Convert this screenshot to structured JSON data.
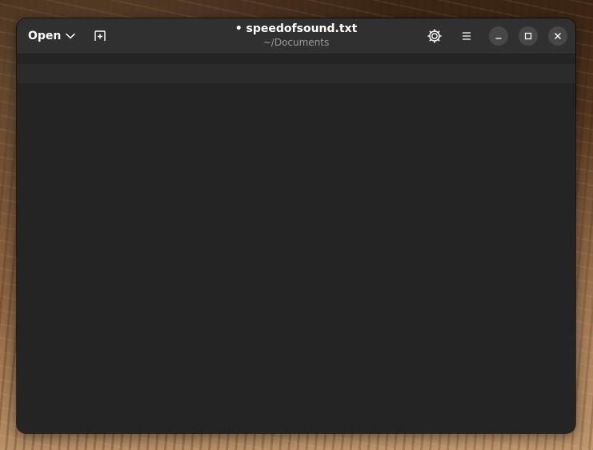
{
  "window": {
    "title": "speedofsound.txt",
    "modified_marker": "•",
    "subtitle": "~/Documents"
  },
  "headerbar": {
    "open_label": "Open",
    "open_icon": "chevron-down-icon",
    "new_tab_icon": "new-tab-icon",
    "settings_icon": "gear-icon",
    "menu_icon": "hamburger-menu-icon",
    "minimize_icon": "minimize-icon",
    "maximize_icon": "maximize-icon",
    "close_icon": "close-icon"
  },
  "editor": {
    "content": ""
  },
  "colors": {
    "window_bg": "#242424",
    "headerbar_bg": "#303030",
    "title_fg": "#ffffff",
    "subtitle_fg": "#9a9a9a",
    "control_bg": "#474747"
  }
}
